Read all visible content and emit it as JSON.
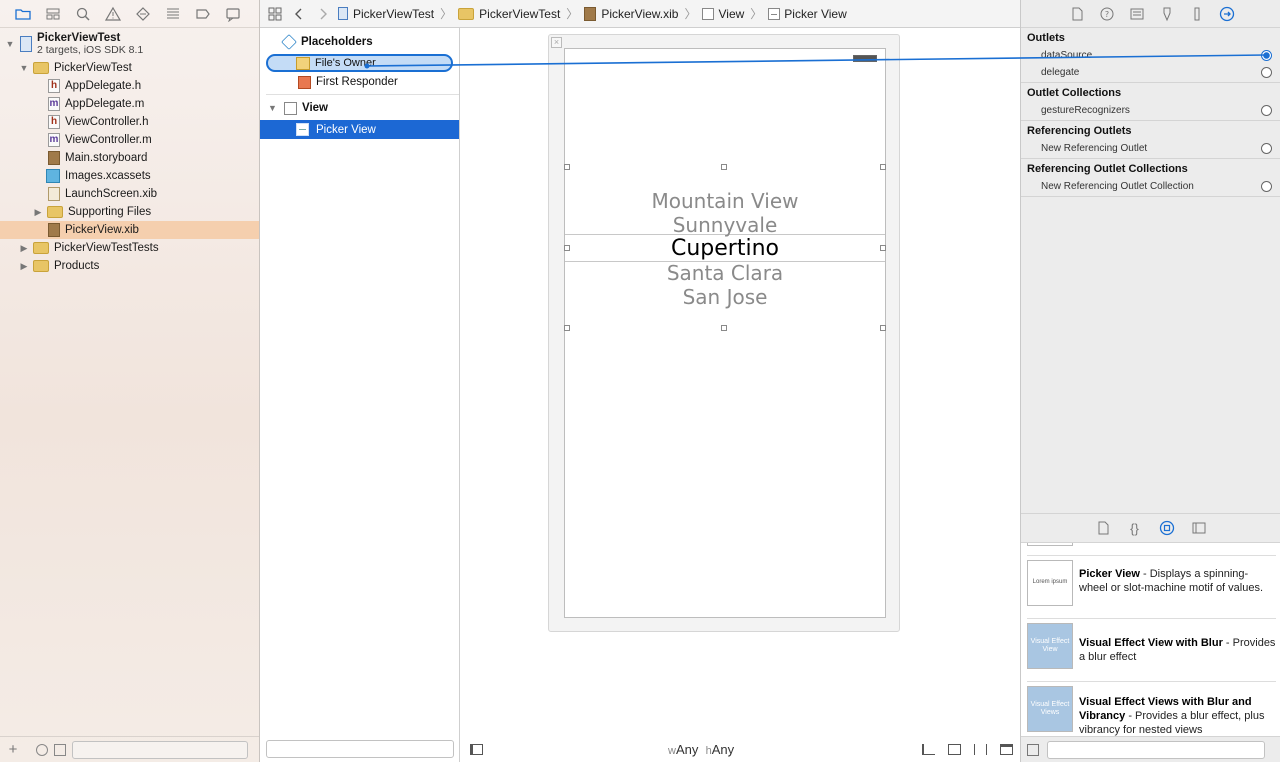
{
  "jumpbar": {
    "crumbs": [
      "PickerViewTest",
      "PickerViewTest",
      "PickerView.xib",
      "View",
      "Picker View"
    ]
  },
  "navigator": {
    "project": {
      "name": "PickerViewTest",
      "subtitle": "2 targets, iOS SDK 8.1"
    },
    "items": [
      {
        "label": "PickerViewTest",
        "kind": "folder"
      },
      {
        "label": "AppDelegate.h",
        "kind": "h"
      },
      {
        "label": "AppDelegate.m",
        "kind": "m"
      },
      {
        "label": "ViewController.h",
        "kind": "h"
      },
      {
        "label": "ViewController.m",
        "kind": "m"
      },
      {
        "label": "Main.storyboard",
        "kind": "storyboard"
      },
      {
        "label": "Images.xcassets",
        "kind": "assets"
      },
      {
        "label": "LaunchScreen.xib",
        "kind": "xib"
      },
      {
        "label": "Supporting Files",
        "kind": "folder"
      },
      {
        "label": "PickerView.xib",
        "kind": "xib",
        "selected": true
      },
      {
        "label": "PickerViewTestTests",
        "kind": "folder"
      },
      {
        "label": "Products",
        "kind": "folder"
      }
    ]
  },
  "outline": {
    "placeholders": "Placeholders",
    "files_owner": "File's Owner",
    "first_responder": "First Responder",
    "view": "View",
    "picker_view": "Picker View"
  },
  "canvas": {
    "picker_items": [
      "Mountain View",
      "Sunnyvale",
      "Cupertino",
      "Santa Clara",
      "San Jose"
    ],
    "selected_index": 2,
    "size_class_w_prefix": "w",
    "size_class_w": "Any",
    "size_class_h_prefix": "h",
    "size_class_h": "Any"
  },
  "inspector": {
    "outlets_title": "Outlets",
    "outlets": [
      "dataSource",
      "delegate"
    ],
    "outlet_collections_title": "Outlet Collections",
    "outlet_collections": [
      "gestureRecognizers"
    ],
    "referencing_outlets_title": "Referencing Outlets",
    "referencing_outlets": [
      "New Referencing Outlet"
    ],
    "referencing_outlet_collections_title": "Referencing Outlet Collections",
    "referencing_outlet_collections": [
      "New Referencing Outlet Collection"
    ]
  },
  "library": {
    "items": [
      {
        "title": "Picker View",
        "desc": " - Displays a spinning-wheel or slot-machine motif of values.",
        "thumb": "Lorem ipsum"
      },
      {
        "title": "Visual Effect View with Blur",
        "desc": " - Provides a blur effect",
        "thumb": "Visual Effect View"
      },
      {
        "title": "Visual Effect Views with Blur and Vibrancy",
        "desc": " - Provides a blur effect, plus vibrancy for nested views",
        "thumb": "Visual Effect Views"
      }
    ]
  },
  "colors": {
    "accent": "#1c68d4",
    "connection": "#1a6fd3",
    "selection_nav": "#f5cfae"
  }
}
